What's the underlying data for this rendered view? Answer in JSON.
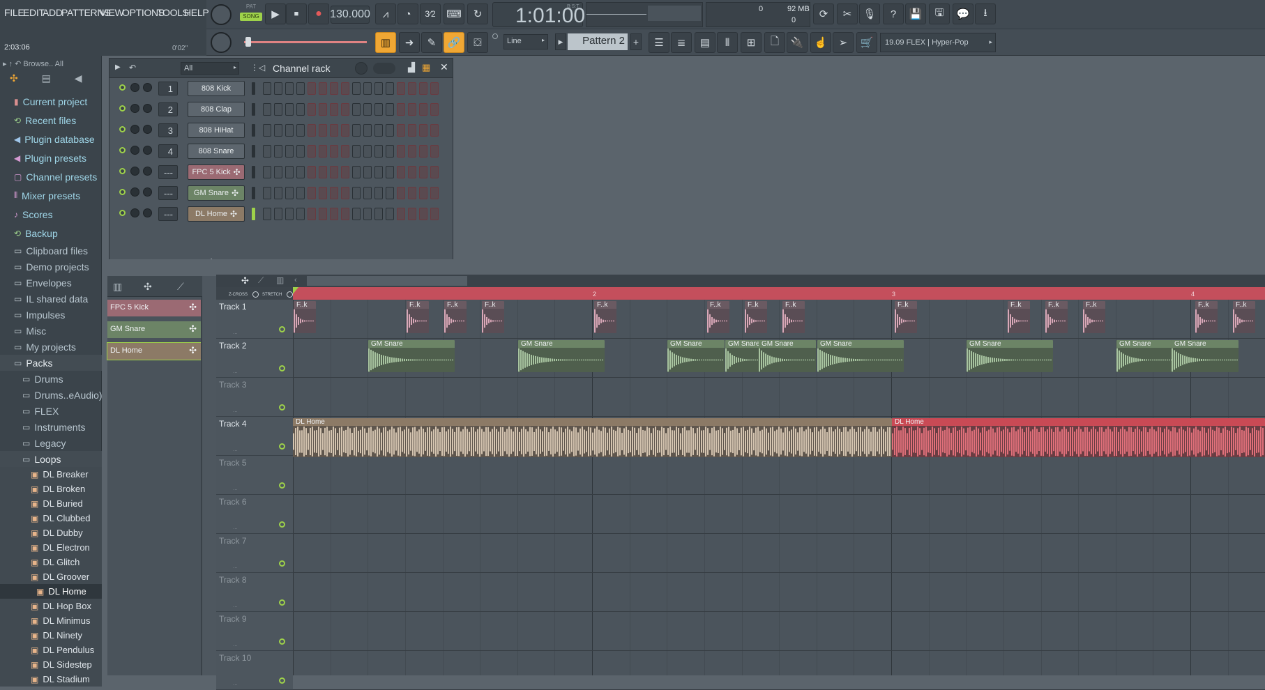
{
  "menu": {
    "file": "FILE",
    "edit": "EDIT",
    "add": "ADD",
    "patterns": "PATTERNS",
    "view": "VIEW",
    "options": "OPTIONS",
    "tools": "TOOLS",
    "help": "HELP"
  },
  "transport": {
    "pat_label": "PAT",
    "song_label": "SONG",
    "tempo": "130.000",
    "time": "1:01:00",
    "time_label": "B:S:T",
    "cpu": "0",
    "memory": "92 MB",
    "voices": "0"
  },
  "hint": {
    "time": "2:03:06",
    "elapsed": "0'02\""
  },
  "toolbar2": {
    "snap": "Line",
    "pattern": "Pattern 2",
    "news": "19.09  FLEX | Hyper-Pop"
  },
  "browser": {
    "header": "Browse.. All",
    "items": [
      {
        "label": "Current project",
        "icon": "project-icon",
        "color": "#d98f8f",
        "depth": 0
      },
      {
        "label": "Recent files",
        "icon": "recent-icon",
        "color": "#9ed28c",
        "depth": 0
      },
      {
        "label": "Plugin database",
        "icon": "plugin-icon",
        "color": "#9fc6ea",
        "depth": 0
      },
      {
        "label": "Plugin presets",
        "icon": "preset-icon",
        "color": "#d59ad2",
        "depth": 0
      },
      {
        "label": "Channel presets",
        "icon": "channel-icon",
        "color": "#d59ad2",
        "depth": 0
      },
      {
        "label": "Mixer presets",
        "icon": "mixer-icon",
        "color": "#d59ad2",
        "depth": 0
      },
      {
        "label": "Scores",
        "icon": "note-icon",
        "color": "#d59ad2",
        "depth": 0
      },
      {
        "label": "Backup",
        "icon": "backup-icon",
        "color": "#9ed28c",
        "depth": 0
      },
      {
        "label": "Clipboard files",
        "icon": "folder-icon",
        "color": "#b9c3ca",
        "depth": 0
      },
      {
        "label": "Demo projects",
        "icon": "folder-icon",
        "color": "#b9c3ca",
        "depth": 0
      },
      {
        "label": "Envelopes",
        "icon": "folder-icon",
        "color": "#b9c3ca",
        "depth": 0
      },
      {
        "label": "IL shared data",
        "icon": "folder-icon",
        "color": "#b9c3ca",
        "depth": 0
      },
      {
        "label": "Impulses",
        "icon": "folder-icon",
        "color": "#b9c3ca",
        "depth": 0
      },
      {
        "label": "Misc",
        "icon": "folder-icon",
        "color": "#b9c3ca",
        "depth": 0
      },
      {
        "label": "My projects",
        "icon": "folder-icon",
        "color": "#b9c3ca",
        "depth": 0
      },
      {
        "label": "Packs",
        "icon": "folder-icon",
        "color": "#b9c3ca",
        "depth": 0,
        "open": true
      },
      {
        "label": "Drums",
        "icon": "folder-icon",
        "color": "#b9c3ca",
        "depth": 1
      },
      {
        "label": "Drums..eAudio)",
        "icon": "folder-icon",
        "color": "#b9c3ca",
        "depth": 1
      },
      {
        "label": "FLEX",
        "icon": "folder-icon",
        "color": "#b9c3ca",
        "depth": 1
      },
      {
        "label": "Instruments",
        "icon": "folder-icon",
        "color": "#b9c3ca",
        "depth": 1
      },
      {
        "label": "Legacy",
        "icon": "folder-icon",
        "color": "#b9c3ca",
        "depth": 1
      },
      {
        "label": "Loops",
        "icon": "folder-icon",
        "color": "#b9c3ca",
        "depth": 1,
        "open": true
      },
      {
        "label": "DL Breaker",
        "icon": "pack-icon",
        "color": "#e7b48a",
        "depth": 2
      },
      {
        "label": "DL Broken",
        "icon": "pack-icon",
        "color": "#e7b48a",
        "depth": 2
      },
      {
        "label": "DL Buried",
        "icon": "pack-icon",
        "color": "#e7b48a",
        "depth": 2
      },
      {
        "label": "DL Clubbed",
        "icon": "pack-icon",
        "color": "#e7b48a",
        "depth": 2
      },
      {
        "label": "DL Dubby",
        "icon": "pack-icon",
        "color": "#e7b48a",
        "depth": 2
      },
      {
        "label": "DL Electron",
        "icon": "pack-icon",
        "color": "#e7b48a",
        "depth": 2
      },
      {
        "label": "DL Glitch",
        "icon": "pack-icon",
        "color": "#e7b48a",
        "depth": 2
      },
      {
        "label": "DL Groover",
        "icon": "pack-icon",
        "color": "#e7b48a",
        "depth": 2
      },
      {
        "label": "DL Home",
        "icon": "pack-icon",
        "color": "#e7b48a",
        "depth": 2,
        "selected": true
      },
      {
        "label": "DL Hop Box",
        "icon": "pack-icon",
        "color": "#e7b48a",
        "depth": 2
      },
      {
        "label": "DL Minimus",
        "icon": "pack-icon",
        "color": "#e7b48a",
        "depth": 2
      },
      {
        "label": "DL Ninety",
        "icon": "pack-icon",
        "color": "#e7b48a",
        "depth": 2
      },
      {
        "label": "DL Pendulus",
        "icon": "pack-icon",
        "color": "#e7b48a",
        "depth": 2
      },
      {
        "label": "DL Sidestep",
        "icon": "pack-icon",
        "color": "#e7b48a",
        "depth": 2
      },
      {
        "label": "DL Stadium",
        "icon": "pack-icon",
        "color": "#e7b48a",
        "depth": 2
      }
    ]
  },
  "rack": {
    "filter": "All",
    "title": "Channel rack",
    "add": "+",
    "channels": [
      {
        "num": "1",
        "name": "808 Kick",
        "color": "#5d666e",
        "steps": [
          0,
          0,
          0,
          0,
          0,
          0,
          0,
          0,
          0,
          0,
          0,
          0,
          0,
          0,
          0,
          0
        ]
      },
      {
        "num": "2",
        "name": "808 Clap",
        "color": "#5d666e",
        "steps": [
          0,
          0,
          0,
          0,
          0,
          0,
          0,
          0,
          0,
          0,
          0,
          0,
          0,
          0,
          0,
          0
        ]
      },
      {
        "num": "3",
        "name": "808 HiHat",
        "color": "#5d666e",
        "steps": [
          0,
          0,
          0,
          0,
          0,
          0,
          0,
          0,
          0,
          0,
          0,
          0,
          0,
          0,
          0,
          0
        ]
      },
      {
        "num": "4",
        "name": "808 Snare",
        "color": "#5d666e",
        "steps": [
          0,
          0,
          0,
          0,
          0,
          0,
          0,
          0,
          0,
          0,
          0,
          0,
          0,
          0,
          0,
          0
        ]
      },
      {
        "num": "---",
        "name": "FPC 5 Kick",
        "color": "#9b6a73",
        "steps": [
          0,
          0,
          0,
          0,
          0,
          0,
          0,
          0,
          0,
          0,
          0,
          0,
          0,
          0,
          0,
          0
        ]
      },
      {
        "num": "---",
        "name": "GM Snare",
        "color": "#6c8466",
        "steps": [
          0,
          0,
          0,
          0,
          0,
          0,
          0,
          0,
          0,
          0,
          0,
          0,
          0,
          0,
          0,
          0
        ]
      },
      {
        "num": "---",
        "name": "DL Home",
        "color": "#8c7a66",
        "steps": [
          0,
          0,
          0,
          0,
          0,
          0,
          0,
          0,
          0,
          0,
          0,
          0,
          0,
          0,
          0,
          0
        ]
      }
    ]
  },
  "picker": [
    {
      "name": "FPC 5 Kick",
      "color": "#9b6a73"
    },
    {
      "name": "GM Snare",
      "color": "#6c8466"
    },
    {
      "name": "DL Home",
      "color": "#8c7a66"
    }
  ],
  "playlist": {
    "zcross": "Z-CROSS",
    "stretch": "STRETCH",
    "bars": [
      "2",
      "3",
      "4"
    ],
    "tracks": [
      "Track 1",
      "Track 2",
      "Track 3",
      "Track 4",
      "Track 5",
      "Track 6",
      "Track 7",
      "Track 8",
      "Track 9",
      "Track 10"
    ],
    "clips": {
      "kick_label": "F..k",
      "snare_label": "GM Snare",
      "loop_label": "DL Home"
    }
  },
  "colors": {
    "accent": "#f0a734",
    "kick": "#d9a8b8",
    "snare": "#a8c4a0",
    "loop": "#d4c4b0",
    "loop_red": "#e0707a"
  }
}
